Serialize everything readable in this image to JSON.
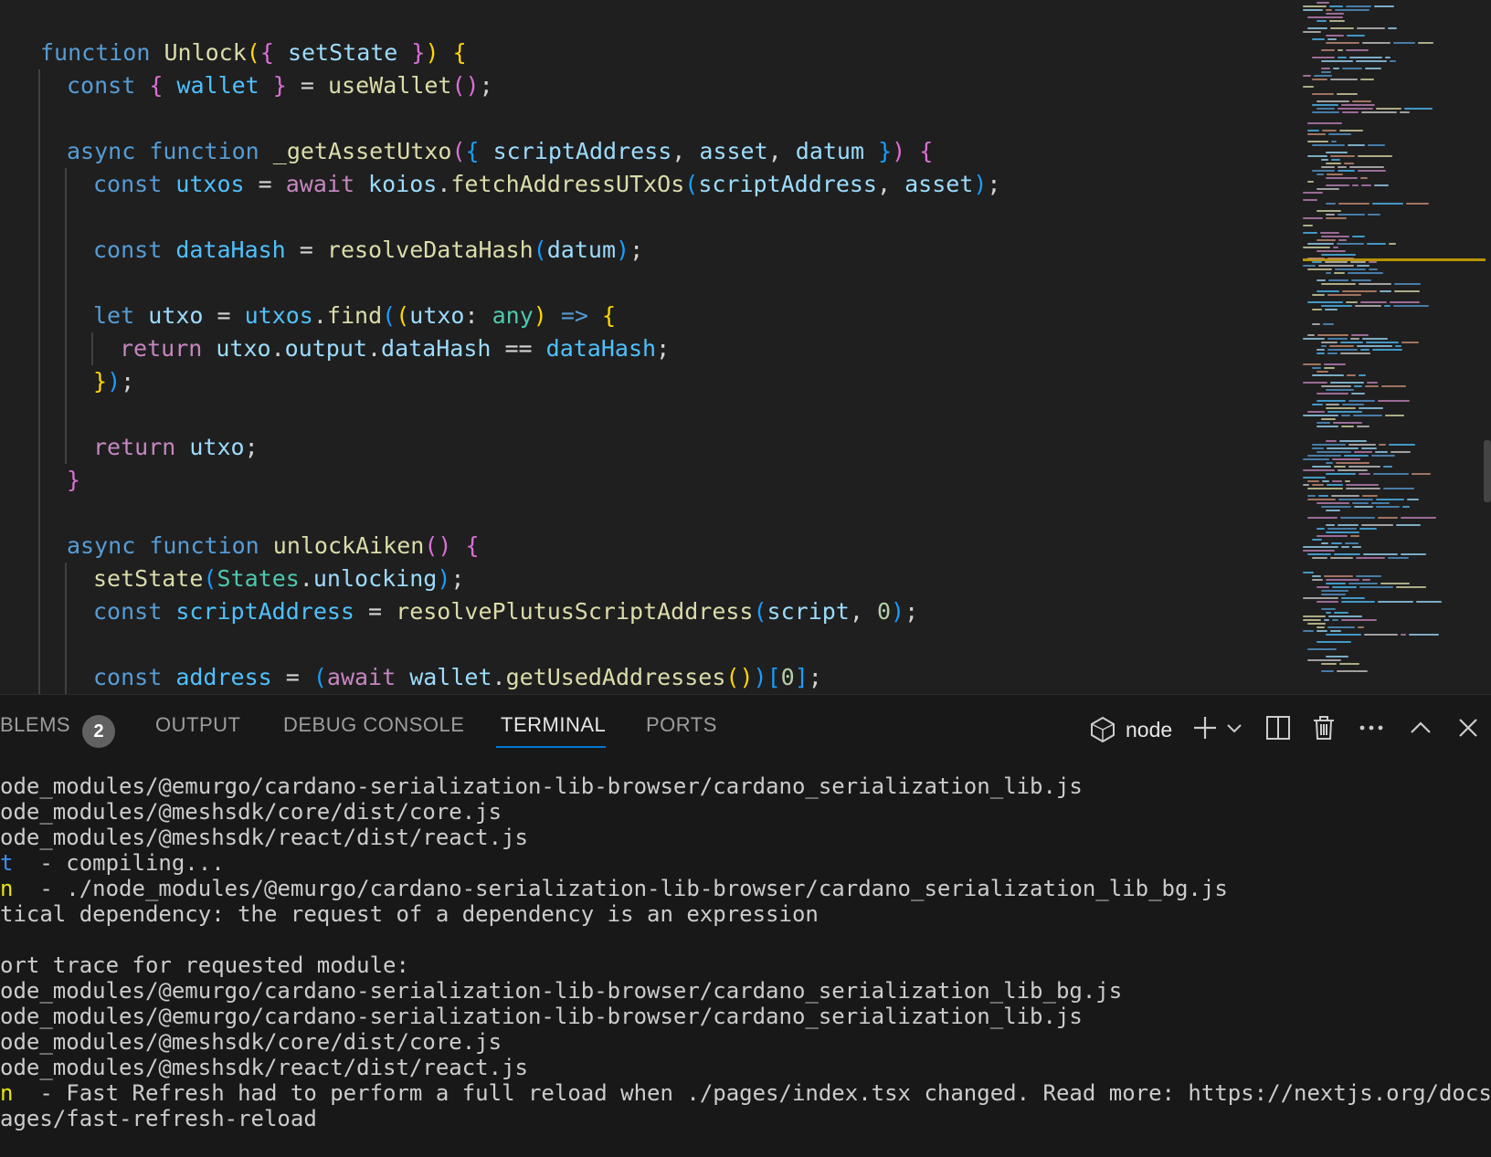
{
  "editor": {
    "lines": [
      {
        "indent": 1,
        "tokens": [
          [
            "kw",
            "function "
          ],
          [
            "fn",
            "Unlock"
          ],
          [
            "b1",
            "("
          ],
          [
            "b2",
            "{ "
          ],
          [
            "vr",
            "setState"
          ],
          [
            "b2",
            " }"
          ],
          [
            "b1",
            ")"
          ],
          [
            "op",
            " "
          ],
          [
            "b1",
            "{"
          ]
        ]
      },
      {
        "indent": 2,
        "tokens": [
          [
            "kw",
            "const "
          ],
          [
            "b2",
            "{ "
          ],
          [
            "cn",
            "wallet"
          ],
          [
            "b2",
            " }"
          ],
          [
            "op",
            " = "
          ],
          [
            "fn",
            "useWallet"
          ],
          [
            "b2",
            "()"
          ],
          [
            "op",
            ";"
          ]
        ]
      },
      {
        "indent": 2,
        "tokens": []
      },
      {
        "indent": 2,
        "tokens": [
          [
            "kw",
            "async "
          ],
          [
            "kw",
            "function "
          ],
          [
            "fn",
            "_getAssetUtxo"
          ],
          [
            "b2",
            "("
          ],
          [
            "b3",
            "{ "
          ],
          [
            "vr",
            "scriptAddress"
          ],
          [
            "op",
            ", "
          ],
          [
            "vr",
            "asset"
          ],
          [
            "op",
            ", "
          ],
          [
            "vr",
            "datum"
          ],
          [
            "b3",
            " }"
          ],
          [
            "b2",
            ")"
          ],
          [
            "op",
            " "
          ],
          [
            "b2",
            "{"
          ]
        ]
      },
      {
        "indent": 3,
        "tokens": [
          [
            "kw",
            "const "
          ],
          [
            "cn",
            "utxos"
          ],
          [
            "op",
            " = "
          ],
          [
            "ctl",
            "await "
          ],
          [
            "vr",
            "koios"
          ],
          [
            "op",
            "."
          ],
          [
            "fn",
            "fetchAddressUTxOs"
          ],
          [
            "b3",
            "("
          ],
          [
            "vr",
            "scriptAddress"
          ],
          [
            "op",
            ", "
          ],
          [
            "vr",
            "asset"
          ],
          [
            "b3",
            ")"
          ],
          [
            "op",
            ";"
          ]
        ]
      },
      {
        "indent": 3,
        "tokens": []
      },
      {
        "indent": 3,
        "tokens": [
          [
            "kw",
            "const "
          ],
          [
            "cn",
            "dataHash"
          ],
          [
            "op",
            " = "
          ],
          [
            "fn",
            "resolveDataHash"
          ],
          [
            "b3",
            "("
          ],
          [
            "vr",
            "datum"
          ],
          [
            "b3",
            ")"
          ],
          [
            "op",
            ";"
          ]
        ]
      },
      {
        "indent": 3,
        "tokens": []
      },
      {
        "indent": 3,
        "tokens": [
          [
            "kw",
            "let "
          ],
          [
            "vr",
            "utxo"
          ],
          [
            "op",
            " = "
          ],
          [
            "cn",
            "utxos"
          ],
          [
            "op",
            "."
          ],
          [
            "fn",
            "find"
          ],
          [
            "b3",
            "("
          ],
          [
            "b1",
            "("
          ],
          [
            "vr",
            "utxo"
          ],
          [
            "op",
            ": "
          ],
          [
            "ty",
            "any"
          ],
          [
            "b1",
            ")"
          ],
          [
            "kw",
            " => "
          ],
          [
            "b1",
            "{"
          ]
        ]
      },
      {
        "indent": 4,
        "tokens": [
          [
            "ctl",
            "return "
          ],
          [
            "vr",
            "utxo"
          ],
          [
            "op",
            "."
          ],
          [
            "vr",
            "output"
          ],
          [
            "op",
            "."
          ],
          [
            "vr",
            "dataHash"
          ],
          [
            "op",
            " == "
          ],
          [
            "cn",
            "dataHash"
          ],
          [
            "op",
            ";"
          ]
        ]
      },
      {
        "indent": 3,
        "tokens": [
          [
            "b1",
            "}"
          ],
          [
            "b3",
            ")"
          ],
          [
            "op",
            ";"
          ]
        ]
      },
      {
        "indent": 3,
        "tokens": []
      },
      {
        "indent": 3,
        "tokens": [
          [
            "ctl",
            "return "
          ],
          [
            "vr",
            "utxo"
          ],
          [
            "op",
            ";"
          ]
        ]
      },
      {
        "indent": 2,
        "tokens": [
          [
            "b2",
            "}"
          ]
        ]
      },
      {
        "indent": 2,
        "tokens": []
      },
      {
        "indent": 2,
        "tokens": [
          [
            "kw",
            "async "
          ],
          [
            "kw",
            "function "
          ],
          [
            "fn",
            "unlockAiken"
          ],
          [
            "b2",
            "()"
          ],
          [
            "op",
            " "
          ],
          [
            "b2",
            "{"
          ]
        ]
      },
      {
        "indent": 3,
        "tokens": [
          [
            "fn",
            "setState"
          ],
          [
            "b3",
            "("
          ],
          [
            "ty",
            "States"
          ],
          [
            "op",
            "."
          ],
          [
            "vr",
            "unlocking"
          ],
          [
            "b3",
            ")"
          ],
          [
            "op",
            ";"
          ]
        ]
      },
      {
        "indent": 3,
        "tokens": [
          [
            "kw",
            "const "
          ],
          [
            "cn",
            "scriptAddress"
          ],
          [
            "op",
            " = "
          ],
          [
            "fn",
            "resolvePlutusScriptAddress"
          ],
          [
            "b3",
            "("
          ],
          [
            "vr",
            "script"
          ],
          [
            "op",
            ", "
          ],
          [
            "nm",
            "0"
          ],
          [
            "b3",
            ")"
          ],
          [
            "op",
            ";"
          ]
        ]
      },
      {
        "indent": 3,
        "tokens": []
      },
      {
        "indent": 3,
        "tokens": [
          [
            "kw",
            "const "
          ],
          [
            "cn",
            "address"
          ],
          [
            "op",
            " = "
          ],
          [
            "b3",
            "("
          ],
          [
            "ctl",
            "await "
          ],
          [
            "vr",
            "wallet"
          ],
          [
            "op",
            "."
          ],
          [
            "fn",
            "getUsedAddresses"
          ],
          [
            "b1",
            "()"
          ],
          [
            "b3",
            ")"
          ],
          [
            "b3",
            "["
          ],
          [
            "nm",
            "0"
          ],
          [
            "b3",
            "]"
          ],
          [
            "op",
            ";"
          ]
        ]
      }
    ]
  },
  "panel": {
    "tabs": [
      {
        "id": "problems",
        "label": "BLEMS"
      },
      {
        "id": "output",
        "label": "OUTPUT"
      },
      {
        "id": "debug-console",
        "label": "DEBUG CONSOLE"
      },
      {
        "id": "terminal",
        "label": "TERMINAL"
      },
      {
        "id": "ports",
        "label": "PORTS"
      }
    ],
    "problems_count": "2",
    "terminal_name": "node",
    "accent_color": "#0078d4"
  },
  "terminal": {
    "lines": [
      {
        "parts": [
          [
            "#cccccc",
            "ode_modules/@emurgo/cardano-serialization-lib-browser/cardano_serialization_lib.js"
          ]
        ]
      },
      {
        "parts": [
          [
            "#cccccc",
            "ode_modules/@meshsdk/core/dist/core.js"
          ]
        ]
      },
      {
        "parts": [
          [
            "#cccccc",
            "ode_modules/@meshsdk/react/dist/react.js"
          ]
        ]
      },
      {
        "parts": [
          [
            "#3b8eea",
            "t"
          ],
          [
            "#cccccc",
            "  - compiling..."
          ]
        ]
      },
      {
        "parts": [
          [
            "#e5e510",
            "n"
          ],
          [
            "#cccccc",
            "  - ./node_modules/@emurgo/cardano-serialization-lib-browser/cardano_serialization_lib_bg.js"
          ]
        ]
      },
      {
        "parts": [
          [
            "#cccccc",
            "tical dependency: the request of a dependency is an expression"
          ]
        ]
      },
      {
        "parts": [
          [
            "#cccccc",
            ""
          ]
        ]
      },
      {
        "parts": [
          [
            "#cccccc",
            "ort trace for requested module:"
          ]
        ]
      },
      {
        "parts": [
          [
            "#cccccc",
            "ode_modules/@emurgo/cardano-serialization-lib-browser/cardano_serialization_lib_bg.js"
          ]
        ]
      },
      {
        "parts": [
          [
            "#cccccc",
            "ode_modules/@emurgo/cardano-serialization-lib-browser/cardano_serialization_lib.js"
          ]
        ]
      },
      {
        "parts": [
          [
            "#cccccc",
            "ode_modules/@meshsdk/core/dist/core.js"
          ]
        ]
      },
      {
        "parts": [
          [
            "#cccccc",
            "ode_modules/@meshsdk/react/dist/react.js"
          ]
        ]
      },
      {
        "parts": [
          [
            "#e5e510",
            "n"
          ],
          [
            "#cccccc",
            "  - Fast Refresh had to perform a full reload when ./pages/index.tsx changed. Read more: https://nextjs.org/docs/m"
          ]
        ]
      },
      {
        "parts": [
          [
            "#cccccc",
            "ages/fast-refresh-reload"
          ]
        ]
      }
    ]
  }
}
